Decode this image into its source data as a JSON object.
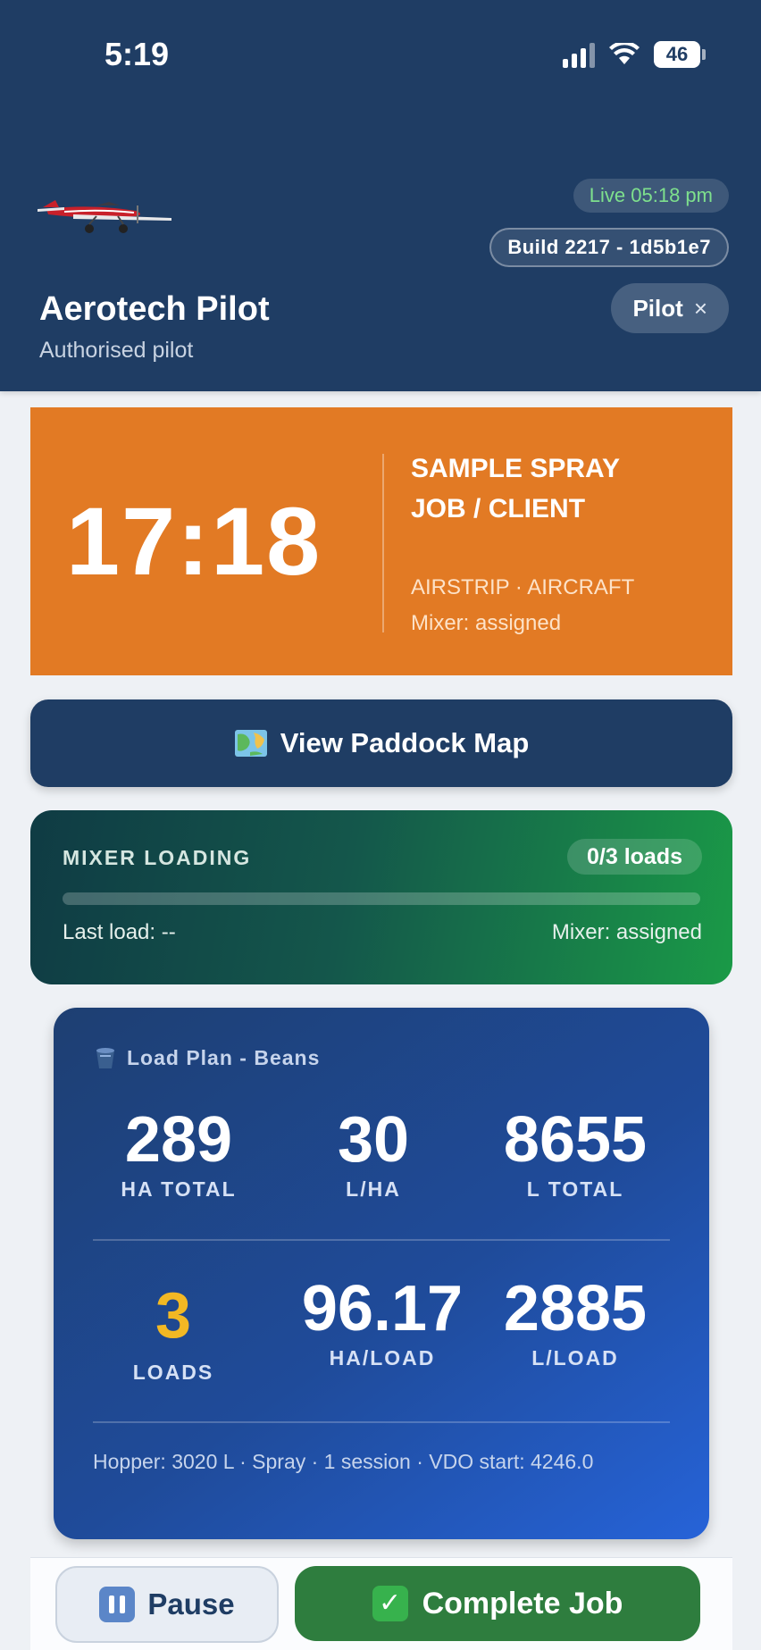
{
  "status_bar": {
    "time": "5:19",
    "battery": "46"
  },
  "header": {
    "live": "Live 05:18 pm",
    "build": "Build 2217 - 1d5b1e7",
    "title": "Aerotech Pilot",
    "subtitle": "Authorised pilot",
    "role_label": "Pilot",
    "role_close": "×"
  },
  "timer_card": {
    "time": "17:18",
    "job_title": "SAMPLE SPRAY JOB / CLIENT",
    "meta": "AIRSTRIP · AIRCRAFT",
    "mixer": "Mixer: assigned",
    "color": "#e27a24"
  },
  "map_button": {
    "label": "View Paddock Map"
  },
  "mixer_loading": {
    "label": "MIXER LOADING",
    "loads": "0/3 loads",
    "progress": 0,
    "last_load": "Last load: --",
    "mixer": "Mixer: assigned"
  },
  "load_plan": {
    "title": "Load Plan - Beans",
    "stats": [
      {
        "value": "289",
        "label": "HA TOTAL"
      },
      {
        "value": "30",
        "label": "L/HA"
      },
      {
        "value": "8655",
        "label": "L TOTAL"
      },
      {
        "value": "3",
        "label": "LOADS"
      },
      {
        "value": "96.17",
        "label": "HA/LOAD"
      },
      {
        "value": "2885",
        "label": "L/LOAD"
      }
    ],
    "footer": "Hopper: 3020 L · Spray · 1 session · VDO start: 4246.0",
    "accent_color": "#f2b824"
  },
  "actions": {
    "pause": "Pause",
    "complete": "Complete Job",
    "complete_color": "#2e7d3e"
  }
}
